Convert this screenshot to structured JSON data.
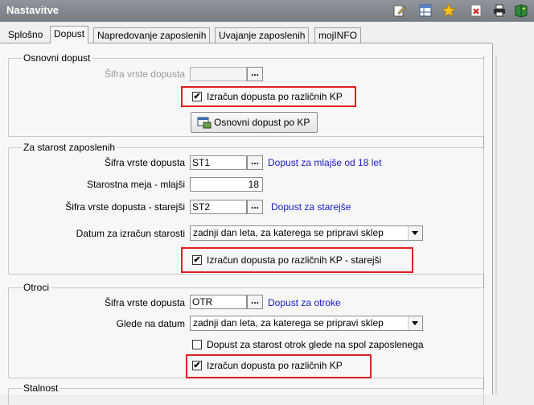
{
  "window": {
    "title": "Nastavitve"
  },
  "toolbar_icons": [
    "edit-icon",
    "table-icon",
    "star-icon",
    "delete-icon",
    "print-icon",
    "book-icon"
  ],
  "tabs": [
    {
      "label": "Splošno"
    },
    {
      "label": "Dopust"
    },
    {
      "label": "Napredovanje zaposlenih"
    },
    {
      "label": "Uvajanje zaposlenih"
    },
    {
      "label": "mojINFO"
    }
  ],
  "osnovni": {
    "legend": "Osnovni dopust",
    "sifra_label": "Šifra vrste dopusta",
    "sifra_value": "",
    "dots": "...",
    "checkbox_label": "Izračun dopusta po različnih KP",
    "checkbox_checked": "✔",
    "button_label": "Osnovni dopust po KP"
  },
  "starost": {
    "legend": "Za starost zaposlenih",
    "sifra_label": "Šifra vrste dopusta",
    "sifra_value": "ST1",
    "sifra_desc": "Dopust za mlajše od 18 let",
    "meja_label": "Starostna meja - mlajši",
    "meja_value": "18",
    "sifra_starejsi_label": "Šifra vrste dopusta - starejši",
    "sifra_starejsi_value": "ST2",
    "sifra_starejsi_desc": "Dopust za starejše",
    "datum_label": "Datum za izračun starosti",
    "datum_value": "zadnji dan leta, za katerega se pripravi sklep",
    "dots": "...",
    "checkbox_label": "Izračun dopusta po različnih KP - starejši",
    "checkbox_checked": "✔"
  },
  "otroci": {
    "legend": "Otroci",
    "sifra_label": "Šifra vrste dopusta",
    "sifra_value": "OTR",
    "sifra_desc": "Dopust za otroke",
    "datum_label": "Glede na datum",
    "datum_value": "zadnji dan leta, za katerega se pripravi sklep",
    "dots": "...",
    "spol_label": "Dopust za starost otrok glede na spol zaposlenega",
    "spol_checked": "",
    "checkbox_label": "Izračun dopusta po različnih KP",
    "checkbox_checked": "✔"
  },
  "stalnost": {
    "legend": "Stalnost"
  }
}
